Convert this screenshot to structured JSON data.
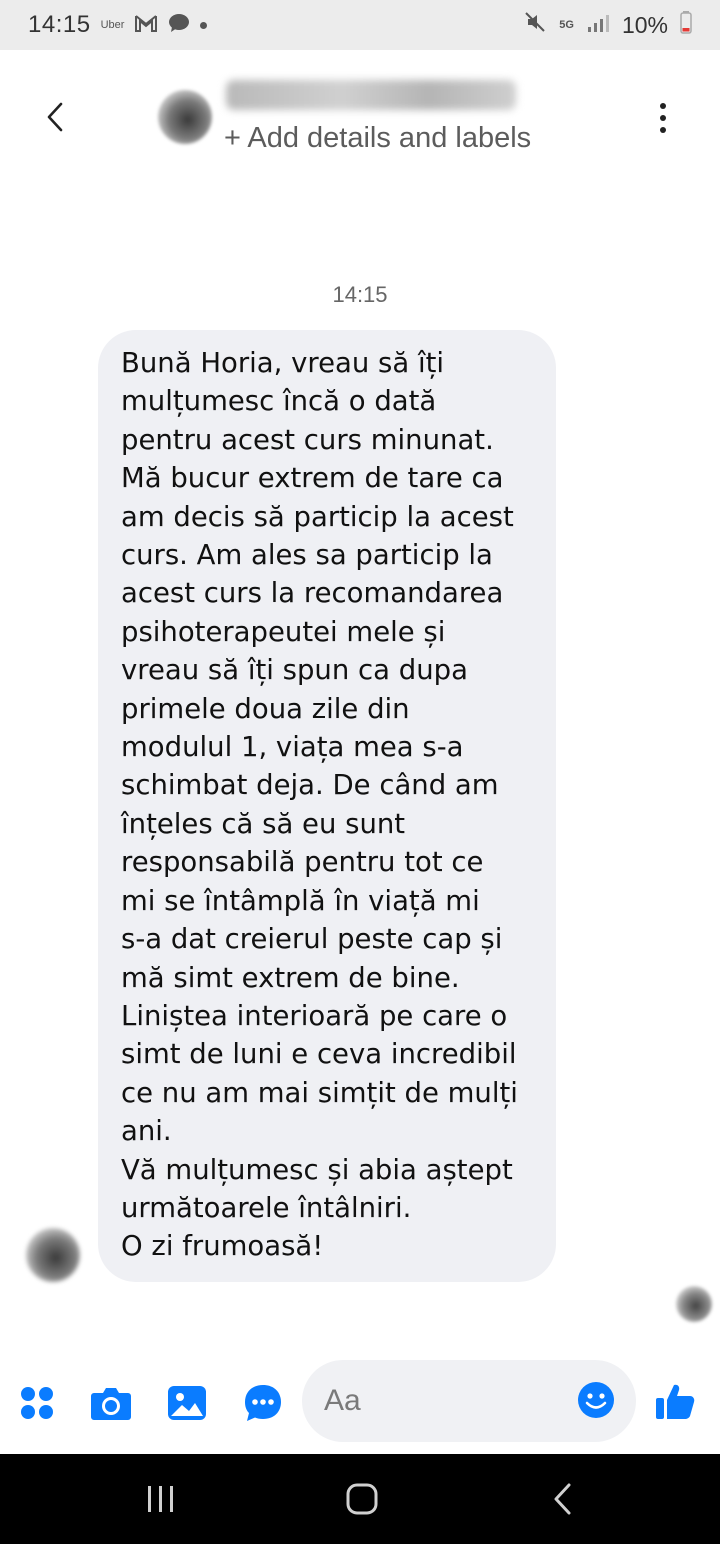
{
  "status_bar": {
    "time": "14:15",
    "uber_label": "Uber",
    "network_label": "5G",
    "battery": "10%"
  },
  "header": {
    "subtitle": "+ Add details and labels"
  },
  "conversation": {
    "timestamp": "14:15",
    "message": "Bună Horia, vreau să îți\nmulțumesc încă o dată\npentru acest curs minunat.\nMă bucur extrem de tare ca\nam decis să particip la acest\ncurs. Am ales sa particip la\nacest curs la recomandarea\npsihoterapeutei mele și\nvreau să îți spun ca dupa\nprimele doua zile din\nmodulul 1, viața mea s-a\nschimbat deja. De când am\nînțeles că să eu sunt\nresponsabilă pentru tot ce\nmi se întâmplă în viață mi\ns-a dat creierul peste cap și\nmă simt extrem de bine.\nLiniștea interioară pe care o\nsimt de luni e ceva incredibil\nce nu am mai simțit de mulți\nani.\nVă mulțumesc și abia aștept\nurmătoarele întâlniri.\nO zi frumoasă!"
  },
  "composer": {
    "placeholder": "Aa"
  },
  "colors": {
    "accent": "#0a7cff",
    "bubble_bg": "#eff0f4",
    "status_bar_bg": "#ececec",
    "nav_bar_bg": "#000000"
  },
  "icons": {
    "composer": [
      "menu-dots-icon",
      "camera-icon",
      "gallery-icon",
      "chat-bubble-icon",
      "emoji-icon",
      "thumbs-up-icon"
    ],
    "nav": [
      "recent-apps-icon",
      "home-icon",
      "back-icon"
    ]
  }
}
